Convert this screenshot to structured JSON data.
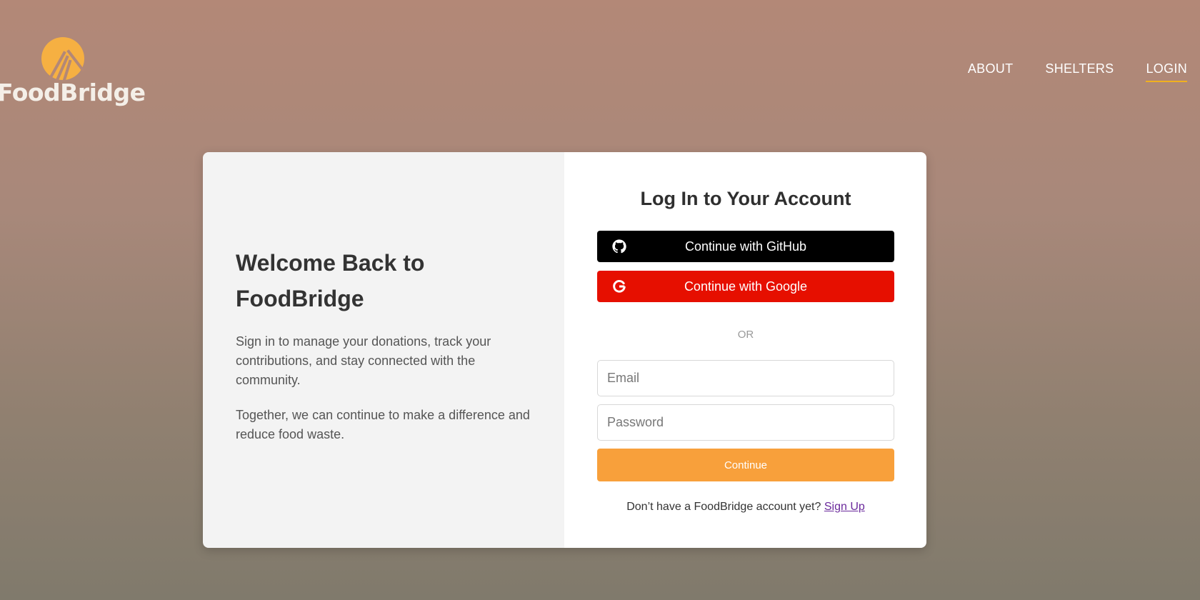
{
  "brand": {
    "name": "FoodBridge",
    "color": "#f6b042"
  },
  "nav": {
    "items": [
      {
        "label": "ABOUT"
      },
      {
        "label": "SHELTERS"
      },
      {
        "label": "LOGIN",
        "active": true
      }
    ],
    "active_underline_color": "#f0b020"
  },
  "welcome": {
    "title": "Welcome Back to FoodBridge",
    "paragraph1": "Sign in to manage your donations, track your contributions, and stay connected with the community.",
    "paragraph2": "Together, we can continue to make a difference and reduce food waste."
  },
  "login": {
    "title": "Log In to Your Account",
    "github_label": "Continue with GitHub",
    "github_icon": "github-icon",
    "google_label": "Continue with Google",
    "google_icon": "google-icon",
    "divider": "OR",
    "email_placeholder": "Email",
    "password_placeholder": "Password",
    "continue_label": "Continue",
    "signup_prompt": "Don’t have a FoodBridge account yet?",
    "signup_link": "Sign Up"
  },
  "colors": {
    "github": "#000000",
    "google": "#e60f00",
    "continue": "#f8a03b",
    "signup_link": "#6b2a9c"
  }
}
